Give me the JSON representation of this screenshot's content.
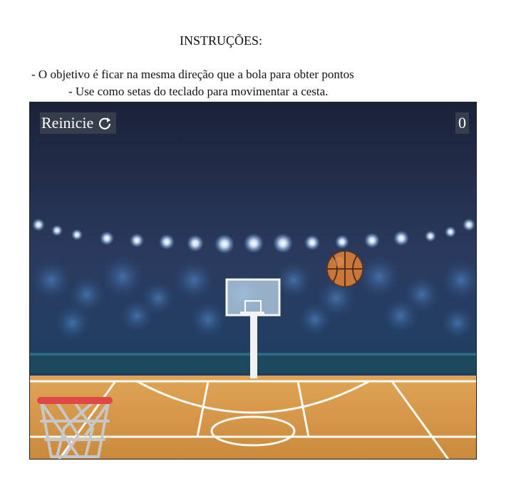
{
  "instructions": {
    "title": "INSTRUÇÕES:",
    "line1": "- O objetivo é ficar na mesma direção que a bola para obter pontos",
    "line2": "- Use como setas do teclado para movimentar a cesta."
  },
  "game": {
    "restart_label": "Reinicie",
    "restart_icon": "refresh-icon",
    "score": "0",
    "colors": {
      "rim": "#e04848",
      "court": "#d79a48",
      "ball": "#c9773a",
      "sky": "#1f2a44"
    }
  }
}
